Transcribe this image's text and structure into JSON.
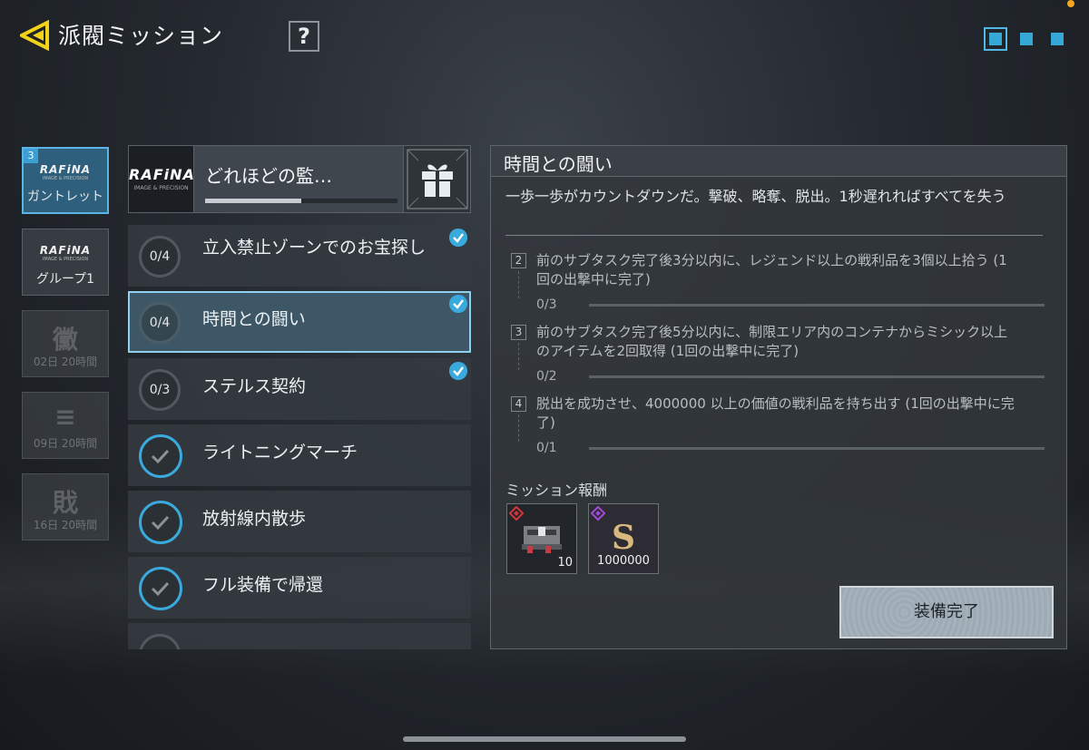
{
  "header": {
    "title": "派閥ミッション",
    "help_label": "?",
    "page_dots": 3,
    "active_page": 0
  },
  "categories": [
    {
      "badge": "3",
      "logo": "RAFiNA",
      "logo_sub": "IMAGE & PRECISION",
      "label": "ガントレット",
      "state": "active"
    },
    {
      "badge": "",
      "logo": "RAFiNA",
      "logo_sub": "IMAGE & PRECISION",
      "label": "グループ1",
      "state": "normal"
    },
    {
      "badge": "",
      "glyph": "黴",
      "label": "02日 20時間",
      "state": "locked"
    },
    {
      "badge": "",
      "glyph": "≡",
      "label": "09日 20時間",
      "state": "locked"
    },
    {
      "badge": "",
      "glyph": "戝",
      "label": "16日 20時間",
      "state": "locked"
    }
  ],
  "mission_group": {
    "logo": "RAFiNA",
    "logo_sub": "IMAGE & PRECISION",
    "title": "どれほどの監…",
    "progress": 0.5
  },
  "missions": [
    {
      "counter": "0/4",
      "title": "立入禁止ゾーンでのお宝探し",
      "checked": true,
      "completed": false,
      "selected": false
    },
    {
      "counter": "0/4",
      "title": "時間との闘い",
      "checked": true,
      "completed": false,
      "selected": true
    },
    {
      "counter": "0/3",
      "title": "ステルス契約",
      "checked": true,
      "completed": false,
      "selected": false
    },
    {
      "counter": "",
      "title": "ライトニングマーチ",
      "checked": false,
      "completed": true,
      "selected": false
    },
    {
      "counter": "",
      "title": "放射線内散歩",
      "checked": false,
      "completed": true,
      "selected": false
    },
    {
      "counter": "",
      "title": "フル装備で帰還",
      "checked": false,
      "completed": true,
      "selected": false
    }
  ],
  "detail": {
    "title": "時間との闘い",
    "description": "一歩一歩がカウントダウンだ。撃破、略奪、脱出。1秒遅れればすべてを失う",
    "subtasks": [
      {
        "num": "2",
        "text": "前のサブタスク完了後3分以内に、レジェンド以上の戦利品を3個以上拾う (1回の出撃中に完了)",
        "count": "0/3"
      },
      {
        "num": "3",
        "text": "前のサブタスク完了後5分以内に、制限エリア内のコンテナからミシック以上のアイテムを2回取得 (1回の出撃中に完了)",
        "count": "0/2"
      },
      {
        "num": "4",
        "text": "脱出を成功させ、4000000 以上の価値の戦利品を持ち出す (1回の出撃中に完了)",
        "count": "0/1"
      }
    ],
    "reward_label": "ミッション報酬",
    "rewards": [
      {
        "type": "item",
        "rarity_color": "#d8333a",
        "qty": "10"
      },
      {
        "type": "currency",
        "rarity_color": "#a34ad8",
        "symbol": "S",
        "qty": "1000000"
      }
    ],
    "equip_button": "装備完了"
  }
}
